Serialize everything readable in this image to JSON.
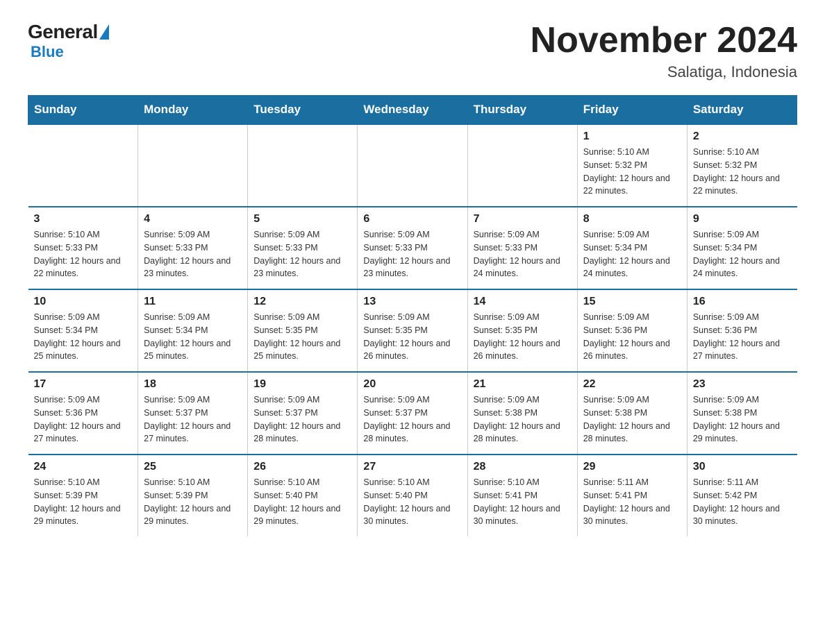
{
  "logo": {
    "general": "General",
    "blue": "Blue"
  },
  "title": {
    "month_year": "November 2024",
    "location": "Salatiga, Indonesia"
  },
  "weekdays": [
    "Sunday",
    "Monday",
    "Tuesday",
    "Wednesday",
    "Thursday",
    "Friday",
    "Saturday"
  ],
  "weeks": [
    [
      {
        "day": "",
        "sunrise": "",
        "sunset": "",
        "daylight": ""
      },
      {
        "day": "",
        "sunrise": "",
        "sunset": "",
        "daylight": ""
      },
      {
        "day": "",
        "sunrise": "",
        "sunset": "",
        "daylight": ""
      },
      {
        "day": "",
        "sunrise": "",
        "sunset": "",
        "daylight": ""
      },
      {
        "day": "",
        "sunrise": "",
        "sunset": "",
        "daylight": ""
      },
      {
        "day": "1",
        "sunrise": "Sunrise: 5:10 AM",
        "sunset": "Sunset: 5:32 PM",
        "daylight": "Daylight: 12 hours and 22 minutes."
      },
      {
        "day": "2",
        "sunrise": "Sunrise: 5:10 AM",
        "sunset": "Sunset: 5:32 PM",
        "daylight": "Daylight: 12 hours and 22 minutes."
      }
    ],
    [
      {
        "day": "3",
        "sunrise": "Sunrise: 5:10 AM",
        "sunset": "Sunset: 5:33 PM",
        "daylight": "Daylight: 12 hours and 22 minutes."
      },
      {
        "day": "4",
        "sunrise": "Sunrise: 5:09 AM",
        "sunset": "Sunset: 5:33 PM",
        "daylight": "Daylight: 12 hours and 23 minutes."
      },
      {
        "day": "5",
        "sunrise": "Sunrise: 5:09 AM",
        "sunset": "Sunset: 5:33 PM",
        "daylight": "Daylight: 12 hours and 23 minutes."
      },
      {
        "day": "6",
        "sunrise": "Sunrise: 5:09 AM",
        "sunset": "Sunset: 5:33 PM",
        "daylight": "Daylight: 12 hours and 23 minutes."
      },
      {
        "day": "7",
        "sunrise": "Sunrise: 5:09 AM",
        "sunset": "Sunset: 5:33 PM",
        "daylight": "Daylight: 12 hours and 24 minutes."
      },
      {
        "day": "8",
        "sunrise": "Sunrise: 5:09 AM",
        "sunset": "Sunset: 5:34 PM",
        "daylight": "Daylight: 12 hours and 24 minutes."
      },
      {
        "day": "9",
        "sunrise": "Sunrise: 5:09 AM",
        "sunset": "Sunset: 5:34 PM",
        "daylight": "Daylight: 12 hours and 24 minutes."
      }
    ],
    [
      {
        "day": "10",
        "sunrise": "Sunrise: 5:09 AM",
        "sunset": "Sunset: 5:34 PM",
        "daylight": "Daylight: 12 hours and 25 minutes."
      },
      {
        "day": "11",
        "sunrise": "Sunrise: 5:09 AM",
        "sunset": "Sunset: 5:34 PM",
        "daylight": "Daylight: 12 hours and 25 minutes."
      },
      {
        "day": "12",
        "sunrise": "Sunrise: 5:09 AM",
        "sunset": "Sunset: 5:35 PM",
        "daylight": "Daylight: 12 hours and 25 minutes."
      },
      {
        "day": "13",
        "sunrise": "Sunrise: 5:09 AM",
        "sunset": "Sunset: 5:35 PM",
        "daylight": "Daylight: 12 hours and 26 minutes."
      },
      {
        "day": "14",
        "sunrise": "Sunrise: 5:09 AM",
        "sunset": "Sunset: 5:35 PM",
        "daylight": "Daylight: 12 hours and 26 minutes."
      },
      {
        "day": "15",
        "sunrise": "Sunrise: 5:09 AM",
        "sunset": "Sunset: 5:36 PM",
        "daylight": "Daylight: 12 hours and 26 minutes."
      },
      {
        "day": "16",
        "sunrise": "Sunrise: 5:09 AM",
        "sunset": "Sunset: 5:36 PM",
        "daylight": "Daylight: 12 hours and 27 minutes."
      }
    ],
    [
      {
        "day": "17",
        "sunrise": "Sunrise: 5:09 AM",
        "sunset": "Sunset: 5:36 PM",
        "daylight": "Daylight: 12 hours and 27 minutes."
      },
      {
        "day": "18",
        "sunrise": "Sunrise: 5:09 AM",
        "sunset": "Sunset: 5:37 PM",
        "daylight": "Daylight: 12 hours and 27 minutes."
      },
      {
        "day": "19",
        "sunrise": "Sunrise: 5:09 AM",
        "sunset": "Sunset: 5:37 PM",
        "daylight": "Daylight: 12 hours and 28 minutes."
      },
      {
        "day": "20",
        "sunrise": "Sunrise: 5:09 AM",
        "sunset": "Sunset: 5:37 PM",
        "daylight": "Daylight: 12 hours and 28 minutes."
      },
      {
        "day": "21",
        "sunrise": "Sunrise: 5:09 AM",
        "sunset": "Sunset: 5:38 PM",
        "daylight": "Daylight: 12 hours and 28 minutes."
      },
      {
        "day": "22",
        "sunrise": "Sunrise: 5:09 AM",
        "sunset": "Sunset: 5:38 PM",
        "daylight": "Daylight: 12 hours and 28 minutes."
      },
      {
        "day": "23",
        "sunrise": "Sunrise: 5:09 AM",
        "sunset": "Sunset: 5:38 PM",
        "daylight": "Daylight: 12 hours and 29 minutes."
      }
    ],
    [
      {
        "day": "24",
        "sunrise": "Sunrise: 5:10 AM",
        "sunset": "Sunset: 5:39 PM",
        "daylight": "Daylight: 12 hours and 29 minutes."
      },
      {
        "day": "25",
        "sunrise": "Sunrise: 5:10 AM",
        "sunset": "Sunset: 5:39 PM",
        "daylight": "Daylight: 12 hours and 29 minutes."
      },
      {
        "day": "26",
        "sunrise": "Sunrise: 5:10 AM",
        "sunset": "Sunset: 5:40 PM",
        "daylight": "Daylight: 12 hours and 29 minutes."
      },
      {
        "day": "27",
        "sunrise": "Sunrise: 5:10 AM",
        "sunset": "Sunset: 5:40 PM",
        "daylight": "Daylight: 12 hours and 30 minutes."
      },
      {
        "day": "28",
        "sunrise": "Sunrise: 5:10 AM",
        "sunset": "Sunset: 5:41 PM",
        "daylight": "Daylight: 12 hours and 30 minutes."
      },
      {
        "day": "29",
        "sunrise": "Sunrise: 5:11 AM",
        "sunset": "Sunset: 5:41 PM",
        "daylight": "Daylight: 12 hours and 30 minutes."
      },
      {
        "day": "30",
        "sunrise": "Sunrise: 5:11 AM",
        "sunset": "Sunset: 5:42 PM",
        "daylight": "Daylight: 12 hours and 30 minutes."
      }
    ]
  ]
}
